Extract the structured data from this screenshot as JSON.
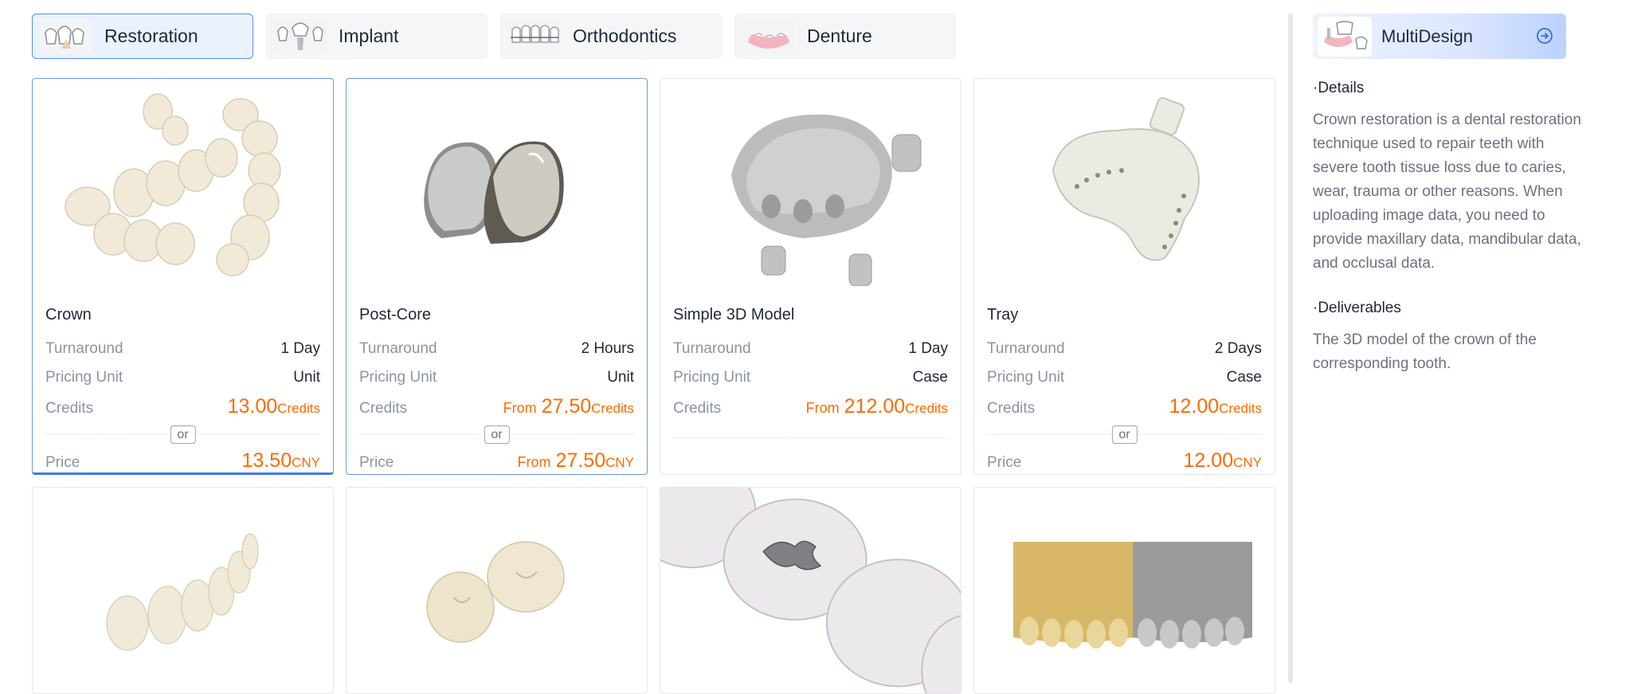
{
  "tabs": [
    {
      "label": "Restoration",
      "icon": "restoration-icon",
      "active": true
    },
    {
      "label": "Implant",
      "icon": "implant-icon",
      "active": false
    },
    {
      "label": "Orthodontics",
      "icon": "orthodontics-icon",
      "active": false
    },
    {
      "label": "Denture",
      "icon": "denture-icon",
      "active": false
    }
  ],
  "labels": {
    "turnaround": "Turnaround",
    "pricing_unit": "Pricing Unit",
    "credits": "Credits",
    "price": "Price",
    "or": "or",
    "from": "From",
    "credits_unit": "Credits",
    "cny": "CNY"
  },
  "products": [
    {
      "name": "Crown",
      "turnaround": "1 Day",
      "pricing_unit": "Unit",
      "credits": "13.00",
      "price": "13.50",
      "from": false,
      "has_price": true,
      "image": "crown-image"
    },
    {
      "name": "Post-Core",
      "turnaround": "2 Hours",
      "pricing_unit": "Unit",
      "credits": "27.50",
      "price": "27.50",
      "from": true,
      "has_price": true,
      "image": "post-core-image"
    },
    {
      "name": "Simple 3D Model",
      "turnaround": "1 Day",
      "pricing_unit": "Case",
      "credits": "212.00",
      "from": true,
      "has_price": false,
      "image": "3d-model-image"
    },
    {
      "name": "Tray",
      "turnaround": "2 Days",
      "pricing_unit": "Case",
      "credits": "12.00",
      "price": "12.00",
      "from": false,
      "has_price": true,
      "image": "tray-image"
    }
  ],
  "products_row2": [
    {
      "image": "veneer-image"
    },
    {
      "image": "inlay-image"
    },
    {
      "image": "onlay-image"
    },
    {
      "image": "model-comparison-image"
    }
  ],
  "side": {
    "button_label": "MultiDesign",
    "details_title": "·Details",
    "details_text": "Crown restoration is a dental restoration technique used to repair teeth with severe tooth tissue loss due to caries, wear, trauma or other reasons. When uploading image data, you need to provide maxillary data, mandibular data, and occlusal data.",
    "deliverables_title": "·Deliverables",
    "deliverables_text": "The 3D model of the crown of the corresponding tooth."
  },
  "colors": {
    "accent": "#3f78f0",
    "price": "#ff6a00"
  }
}
